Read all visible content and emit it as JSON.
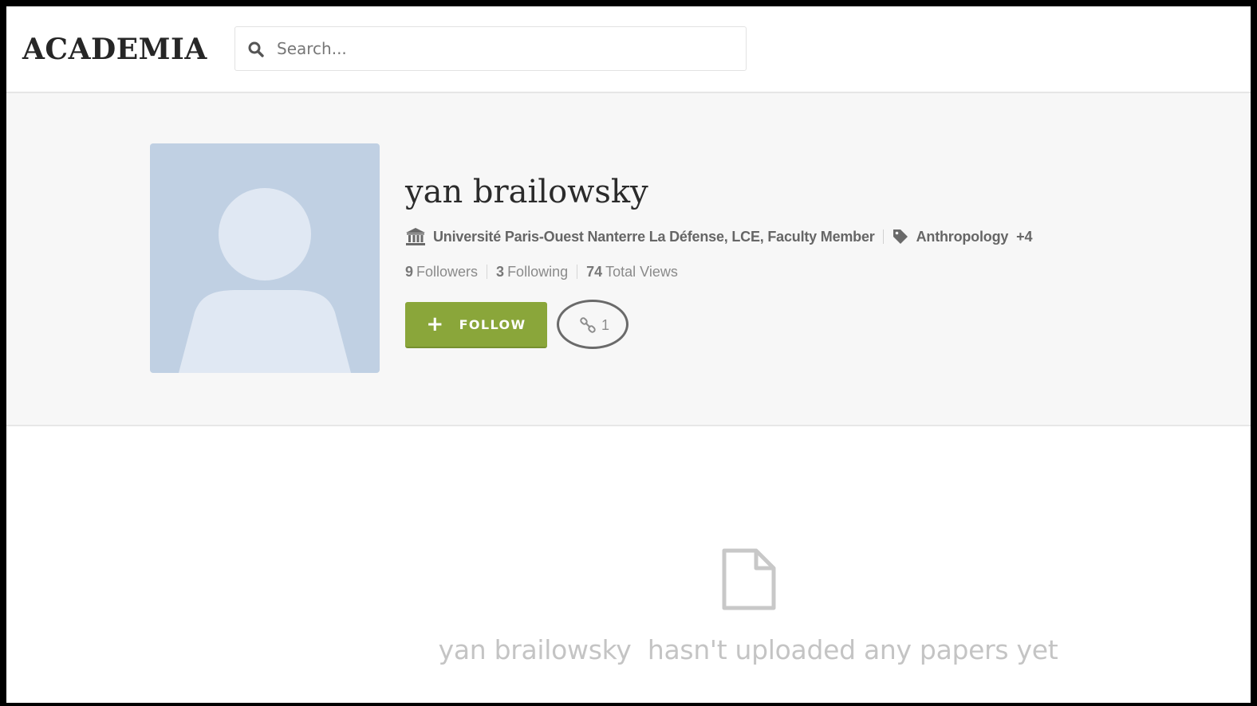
{
  "header": {
    "logo": "ACADEMIA",
    "search_placeholder": "Search..."
  },
  "profile": {
    "name": "yan brailowsky",
    "affiliation": "Université Paris-Ouest Nanterre La Défense, LCE, Faculty Member",
    "research_interest": "Anthropology",
    "more_interests": "+4",
    "stats": {
      "followers_count": "9",
      "followers_label": "Followers",
      "following_count": "3",
      "following_label": "Following",
      "views_count": "74",
      "views_label": "Total Views"
    },
    "follow_label": "FOLLOW",
    "links_count": "1"
  },
  "empty_state": {
    "message": "yan brailowsky  hasn't uploaded any papers yet"
  },
  "colors": {
    "follow_green": "#8aa63a",
    "avatar_bg": "#c0d0e3",
    "band_bg": "#f7f7f7"
  },
  "icons": {
    "search": "search-icon",
    "institution": "institution-icon",
    "tag": "tag-icon",
    "link": "link-icon",
    "document": "document-icon"
  }
}
